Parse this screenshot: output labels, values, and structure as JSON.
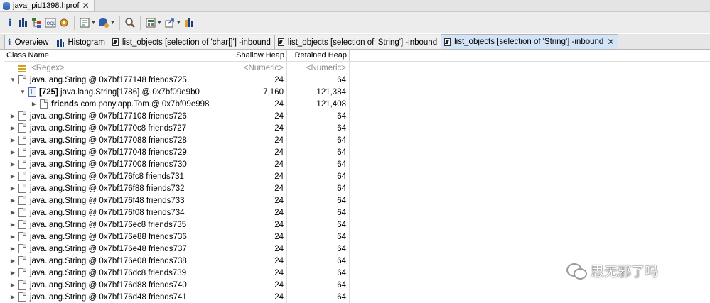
{
  "editor_tab": {
    "title": "java_pid1398.hprof"
  },
  "tabs": [
    {
      "label": "Overview"
    },
    {
      "label": "Histogram"
    },
    {
      "label": "list_objects  [selection of 'char[]'] -inbound"
    },
    {
      "label": "list_objects  [selection of 'String'] -inbound"
    },
    {
      "label": "list_objects  [selection of 'String'] -inbound"
    }
  ],
  "table": {
    "columns": [
      "Class Name",
      "Shallow Heap",
      "Retained Heap"
    ],
    "filter": {
      "name": "<Regex>",
      "shallow": "<Numeric>",
      "retained": "<Numeric>"
    },
    "expanded_rows": [
      {
        "name": "java.lang.String @ 0x7bf177148  friends725",
        "shallow": "24",
        "retained": "64"
      },
      {
        "prefix": "[725]",
        "name": " java.lang.String[1786] @ 0x7bf09e9b0",
        "shallow": "7,160",
        "retained": "121,384"
      },
      {
        "prefix": "friends",
        "name": " com.pony.app.Tom @ 0x7bf09e998",
        "shallow": "24",
        "retained": "121,408"
      }
    ],
    "rows": [
      {
        "name": "java.lang.String @ 0x7bf177108  friends726",
        "shallow": "24",
        "retained": "64"
      },
      {
        "name": "java.lang.String @ 0x7bf1770c8  friends727",
        "shallow": "24",
        "retained": "64"
      },
      {
        "name": "java.lang.String @ 0x7bf177088  friends728",
        "shallow": "24",
        "retained": "64"
      },
      {
        "name": "java.lang.String @ 0x7bf177048  friends729",
        "shallow": "24",
        "retained": "64"
      },
      {
        "name": "java.lang.String @ 0x7bf177008  friends730",
        "shallow": "24",
        "retained": "64"
      },
      {
        "name": "java.lang.String @ 0x7bf176fc8  friends731",
        "shallow": "24",
        "retained": "64"
      },
      {
        "name": "java.lang.String @ 0x7bf176f88  friends732",
        "shallow": "24",
        "retained": "64"
      },
      {
        "name": "java.lang.String @ 0x7bf176f48  friends733",
        "shallow": "24",
        "retained": "64"
      },
      {
        "name": "java.lang.String @ 0x7bf176f08  friends734",
        "shallow": "24",
        "retained": "64"
      },
      {
        "name": "java.lang.String @ 0x7bf176ec8  friends735",
        "shallow": "24",
        "retained": "64"
      },
      {
        "name": "java.lang.String @ 0x7bf176e88  friends736",
        "shallow": "24",
        "retained": "64"
      },
      {
        "name": "java.lang.String @ 0x7bf176e48  friends737",
        "shallow": "24",
        "retained": "64"
      },
      {
        "name": "java.lang.String @ 0x7bf176e08  friends738",
        "shallow": "24",
        "retained": "64"
      },
      {
        "name": "java.lang.String @ 0x7bf176dc8  friends739",
        "shallow": "24",
        "retained": "64"
      },
      {
        "name": "java.lang.String @ 0x7bf176d88  friends740",
        "shallow": "24",
        "retained": "64"
      },
      {
        "name": "java.lang.String @ 0x7bf176d48  friends741",
        "shallow": "24",
        "retained": "64"
      }
    ]
  },
  "watermark": {
    "text": "思无邪了吗"
  },
  "colors": {
    "active_tab": "#d3e4f8",
    "toolbar_bg": "#ececec",
    "info_icon": "#1d4fa0"
  }
}
